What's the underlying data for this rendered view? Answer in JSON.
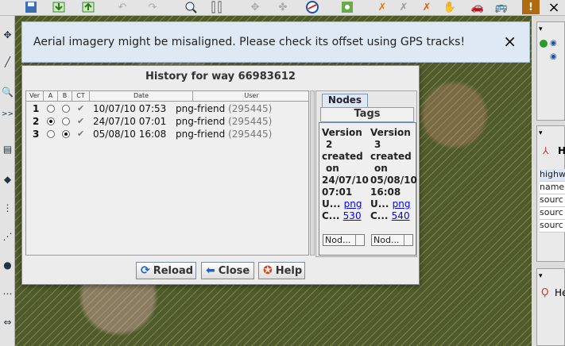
{
  "banner": {
    "message": "Aerial imagery might be misaligned. Please check its offset using GPS tracks!",
    "close_icon": "×"
  },
  "dialog": {
    "title": "History for way 66983612",
    "columns": [
      "Ver",
      "A",
      "B",
      "CT",
      "Date",
      "User"
    ],
    "rows": [
      {
        "ver": "1",
        "a": false,
        "b": false,
        "date": "10/07/10 07:53",
        "user": "png-friend",
        "uid": "(295445)"
      },
      {
        "ver": "2",
        "a": true,
        "b": false,
        "date": "24/07/10 07:01",
        "user": "png-friend",
        "uid": "(295445)"
      },
      {
        "ver": "3",
        "a": false,
        "b": true,
        "date": "05/08/10 16:08",
        "user": "png-friend",
        "uid": "(295445)"
      }
    ],
    "tabs": {
      "nodes": "Nodes",
      "tags": "Tags"
    },
    "versions": [
      {
        "l1": "Version",
        "l2": "2",
        "l3": "created",
        "l4": "on",
        "l5": "24/07/10",
        "l6": "07:01",
        "user_prefix": "U...",
        "user_link": "png",
        "cs_prefix": "C...",
        "cs_link": "530",
        "nodes_btn": "Nod..."
      },
      {
        "l1": "Version",
        "l2": "3",
        "l3": "created",
        "l4": "on",
        "l5": "05/08/10",
        "l6": "16:08",
        "user_prefix": "U...",
        "user_link": "png",
        "cs_prefix": "C...",
        "cs_link": "540",
        "nodes_btn": "Nod..."
      }
    ],
    "buttons": {
      "reload": "Reload",
      "close": "Close",
      "help": "Help"
    }
  },
  "right_panels": {
    "header_text": "H",
    "tag_rows": [
      "highw",
      "name",
      "sourc",
      "sourc",
      "sourc"
    ],
    "relation_text": "He"
  }
}
